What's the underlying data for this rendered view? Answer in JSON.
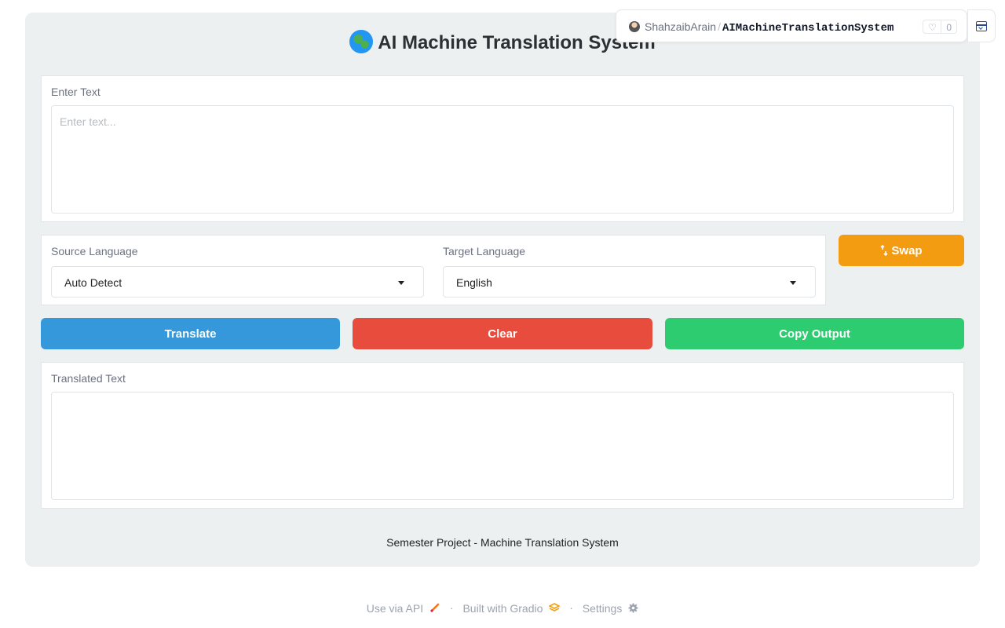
{
  "app": {
    "title": "AI Machine Translation System",
    "title_icon": "globe-icon",
    "footer_note": "Semester Project - Machine Translation System"
  },
  "input": {
    "label": "Enter Text",
    "placeholder": "Enter text...",
    "value": ""
  },
  "source_language": {
    "label": "Source Language",
    "selected": "Auto Detect"
  },
  "target_language": {
    "label": "Target Language",
    "selected": "English"
  },
  "buttons": {
    "swap": "Swap",
    "swap_icon": "swap-arrows-icon",
    "translate": "Translate",
    "clear": "Clear",
    "copy": "Copy Output"
  },
  "output": {
    "label": "Translated Text",
    "value": ""
  },
  "links": {
    "api": "Use via API",
    "gradio": "Built with Gradio",
    "settings": "Settings",
    "separator": "·"
  },
  "space_badge": {
    "user": "ShahzaibArain",
    "separator": "/",
    "repo": "AIMachineTranslationSystem",
    "likes": "0"
  },
  "colors": {
    "translate": "#3498db",
    "clear": "#e74c3c",
    "copy": "#2ecc71",
    "swap": "#f39c12",
    "app_background": "#ecf0f1"
  }
}
